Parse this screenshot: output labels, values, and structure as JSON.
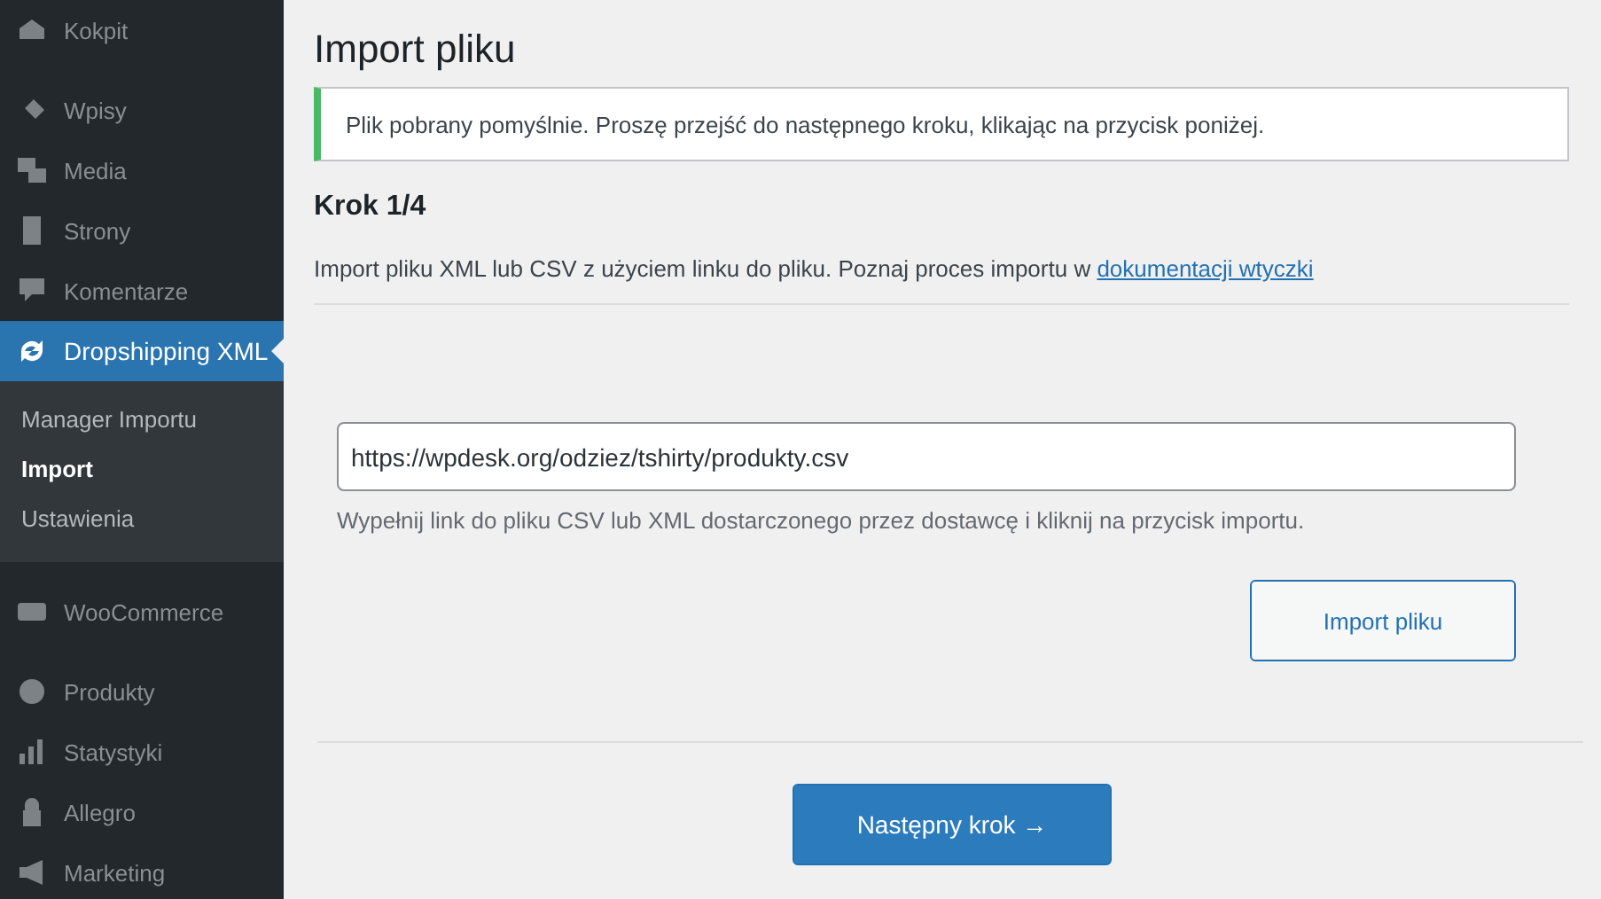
{
  "sidebar": {
    "items_top": [
      {
        "label": "Kokpit",
        "selected": false
      },
      {
        "label": "Wpisy",
        "selected": false
      },
      {
        "label": "Media",
        "selected": false
      },
      {
        "label": "Strony",
        "selected": false
      },
      {
        "label": "Komentarze",
        "selected": false
      },
      {
        "label": "Dropshipping XML",
        "selected": true,
        "children": [
          {
            "label": "Manager Importu",
            "selected": false
          },
          {
            "label": "Import",
            "selected": true
          },
          {
            "label": "Ustawienia",
            "selected": false
          }
        ]
      }
    ],
    "items_bottom": [
      {
        "label": "WooCommerce",
        "selected": false
      },
      {
        "label": "Produkty",
        "selected": false
      },
      {
        "label": "Statystyki",
        "selected": false
      },
      {
        "label": "Allegro",
        "selected": false
      },
      {
        "label": "Marketing",
        "selected": false
      }
    ]
  },
  "page": {
    "title": "Import pliku",
    "notice": {
      "text": "Plik pobrany pomyślnie. Proszę przejść do następnego kroku, klikając na przycisk poniżej."
    },
    "step": "Krok 1/4",
    "description": "Import pliku XML lub CSV z użyciem linku do pliku. Poznaj proces importu w ",
    "description_link": "dokumentacji wtyczki",
    "url_field": {
      "value": "https://wpdesk.org/odziez/tshirty/produkty.csv"
    },
    "hint": "Wypełnij link do pliku CSV lub XML dostarczonego przez dostawcę i kliknij na przycisk importu.",
    "import_button": "Import pliku",
    "next_button": "Następny krok →"
  }
}
